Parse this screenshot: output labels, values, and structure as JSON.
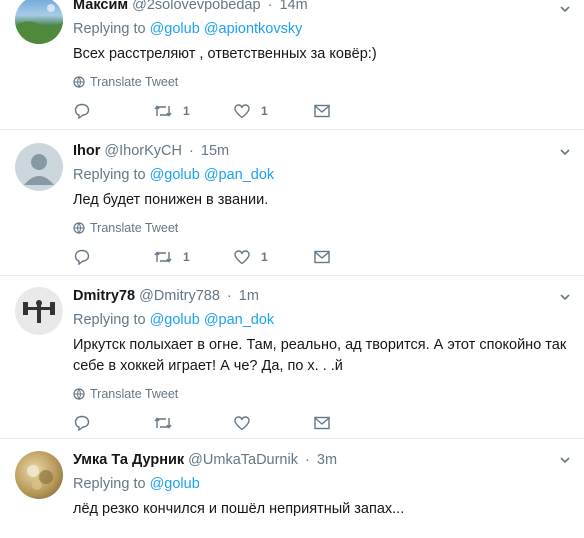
{
  "tweets": [
    {
      "name": "Максим",
      "handle": "@2solovevpobedap",
      "time": "14m",
      "replying_label": "Replying to",
      "mentions": [
        "@golub",
        "@apiontkovsky"
      ],
      "text": "Всех расстреляют , ответственных за ковёр:)",
      "translate": "Translate Tweet",
      "retweets": "1",
      "likes": "1",
      "avatar": "landscape-avatar"
    },
    {
      "name": "Ihor",
      "handle": "@IhorKyCH",
      "time": "15m",
      "replying_label": "Replying to",
      "mentions": [
        "@golub",
        "@pan_dok"
      ],
      "text": "Лед будет понижен в звании.",
      "translate": "Translate Tweet",
      "retweets": "1",
      "likes": "1",
      "avatar": "default-avatar"
    },
    {
      "name": "Dmitry78",
      "handle": "@Dmitry788",
      "time": "1m",
      "replying_label": "Replying to",
      "mentions": [
        "@golub",
        "@pan_dok"
      ],
      "text": "Иркутск полыхает в огне. Там, реально, ад творится. А этот спокойно так себе в хоккей играет! А че? Да, по х. . .й",
      "translate": "Translate Tweet",
      "retweets": "",
      "likes": "",
      "avatar": "barbell-avatar"
    },
    {
      "name": "Умка Та Дурник",
      "handle": "@UmkaTaDurnik",
      "time": "3m",
      "replying_label": "Replying to",
      "mentions": [
        "@golub"
      ],
      "text": "лёд резко кончился и пошёл неприятный запах...",
      "translate": "",
      "retweets": "",
      "likes": "",
      "avatar": "photo-avatar"
    }
  ],
  "colors": {
    "link": "#1da1f2",
    "secondary": "#657786",
    "divider": "#e6ecf0"
  }
}
